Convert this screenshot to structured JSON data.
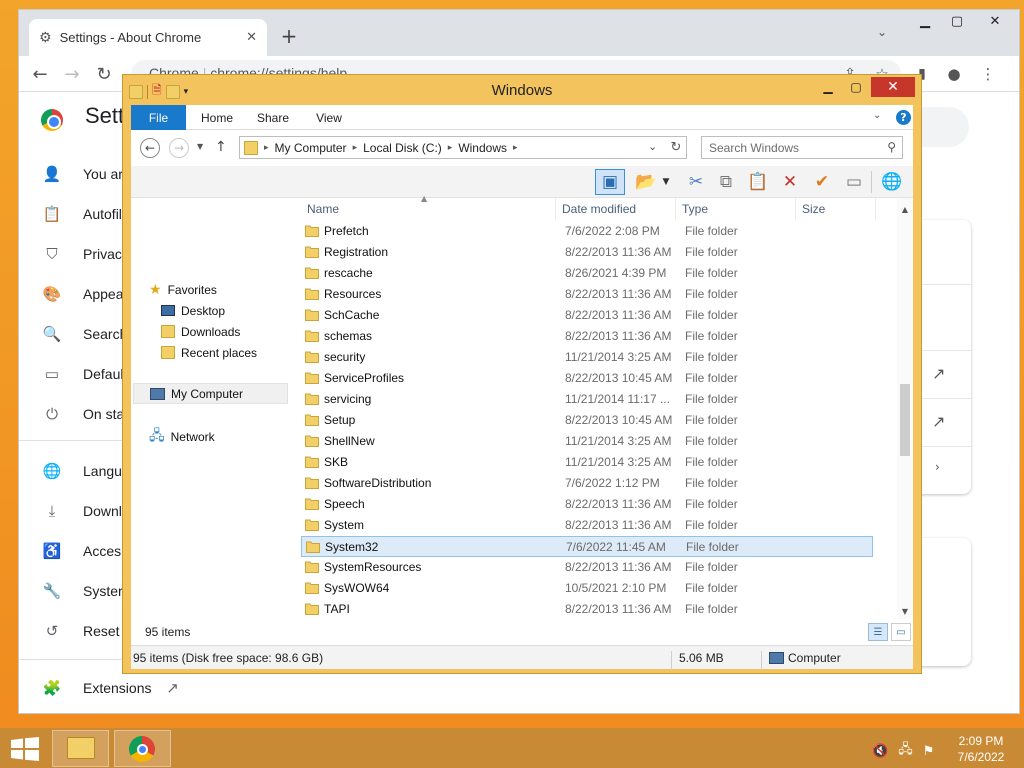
{
  "chrome": {
    "tab_title": "Settings - About Chrome",
    "omnibox_text": "chrome://settings/help",
    "omnibox_prefix": "Chrome",
    "settings_title": "Sett",
    "nav": [
      {
        "label": "You ar",
        "icon": "person-icon"
      },
      {
        "label": "Autofil",
        "icon": "clipboard-icon"
      },
      {
        "label": "Privac",
        "icon": "shield-icon"
      },
      {
        "label": "Appea",
        "icon": "palette-icon"
      },
      {
        "label": "Search",
        "icon": "search-icon"
      },
      {
        "label": "Defaul",
        "icon": "browser-icon"
      },
      {
        "label": "On sta",
        "icon": "power-icon"
      },
      {
        "label": "Langu",
        "icon": "globe-icon"
      },
      {
        "label": "Downl",
        "icon": "download-icon"
      },
      {
        "label": "Acces",
        "icon": "accessibility-icon"
      },
      {
        "label": "Syster",
        "icon": "wrench-icon"
      },
      {
        "label": "Reset",
        "icon": "restore-icon"
      },
      {
        "label": "Extensions",
        "icon": "puzzle-icon"
      }
    ]
  },
  "explorer": {
    "title": "Windows",
    "ribbon_tabs": [
      "File",
      "Home",
      "Share",
      "View"
    ],
    "breadcrumb": [
      "My Computer",
      "Local Disk (C:)",
      "Windows"
    ],
    "search_placeholder": "Search Windows",
    "nav_pane": {
      "favorites": "Favorites",
      "favorite_items": [
        "Desktop",
        "Downloads",
        "Recent places"
      ],
      "computer": "My Computer",
      "network": "Network"
    },
    "columns": [
      "Name",
      "Date modified",
      "Type",
      "Size"
    ],
    "files": [
      {
        "name": "Prefetch",
        "date": "7/6/2022 2:08 PM",
        "type": "File folder"
      },
      {
        "name": "Registration",
        "date": "8/22/2013 11:36 AM",
        "type": "File folder"
      },
      {
        "name": "rescache",
        "date": "8/26/2021 4:39 PM",
        "type": "File folder"
      },
      {
        "name": "Resources",
        "date": "8/22/2013 11:36 AM",
        "type": "File folder"
      },
      {
        "name": "SchCache",
        "date": "8/22/2013 11:36 AM",
        "type": "File folder"
      },
      {
        "name": "schemas",
        "date": "8/22/2013 11:36 AM",
        "type": "File folder"
      },
      {
        "name": "security",
        "date": "11/21/2014 3:25 AM",
        "type": "File folder"
      },
      {
        "name": "ServiceProfiles",
        "date": "8/22/2013 10:45 AM",
        "type": "File folder"
      },
      {
        "name": "servicing",
        "date": "11/21/2014 11:17 ...",
        "type": "File folder"
      },
      {
        "name": "Setup",
        "date": "8/22/2013 10:45 AM",
        "type": "File folder"
      },
      {
        "name": "ShellNew",
        "date": "11/21/2014 3:25 AM",
        "type": "File folder"
      },
      {
        "name": "SKB",
        "date": "11/21/2014 3:25 AM",
        "type": "File folder"
      },
      {
        "name": "SoftwareDistribution",
        "date": "7/6/2022 1:12 PM",
        "type": "File folder"
      },
      {
        "name": "Speech",
        "date": "8/22/2013 11:36 AM",
        "type": "File folder"
      },
      {
        "name": "System",
        "date": "8/22/2013 11:36 AM",
        "type": "File folder"
      },
      {
        "name": "System32",
        "date": "7/6/2022 11:45 AM",
        "type": "File folder",
        "selected": true
      },
      {
        "name": "SystemResources",
        "date": "8/22/2013 11:36 AM",
        "type": "File folder"
      },
      {
        "name": "SysWOW64",
        "date": "10/5/2021 2:10 PM",
        "type": "File folder"
      },
      {
        "name": "TAPI",
        "date": "8/22/2013 11:36 AM",
        "type": "File folder"
      }
    ],
    "items_count": "95 items",
    "status_left": "95 items (Disk free space: 98.6 GB)",
    "status_size": "5.06 MB",
    "status_location": "Computer"
  },
  "taskbar": {
    "time": "2:09 PM",
    "date": "7/6/2022"
  },
  "colors": {
    "accent": "#1979ca",
    "explorer_frame": "#f3c35e",
    "selection": "#dcebf7",
    "taskbar": "#c98a35"
  }
}
